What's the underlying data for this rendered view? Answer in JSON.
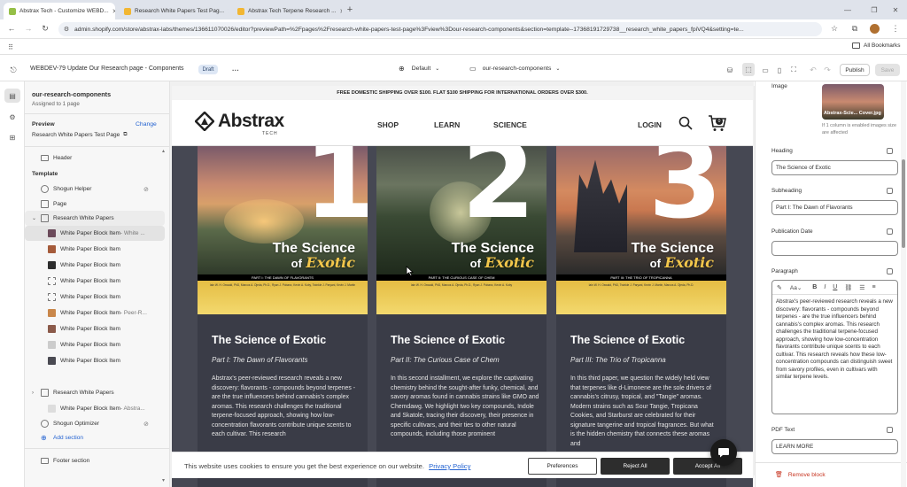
{
  "browser": {
    "tabs": [
      {
        "label": "Abstrax Tech - Customize WEBD...",
        "active": true
      },
      {
        "label": "Research White Papers Test Pag...",
        "active": false
      },
      {
        "label": "Abstrax Tech Terpene Research ...",
        "active": false
      }
    ],
    "url": "admin.shopify.com/store/abstrax-labs/themes/136611070026/editor?previewPath=%2Fpages%2Fresearch-white-papers-test-page%3Fview%3Dour-research-components&section=template--17368191729738__research_white_papers_fpiVQ4&setting=te...",
    "bookmarks_label": "All Bookmarks"
  },
  "editor": {
    "title": "WEBDEV-79 Update Our Research page - Components",
    "badge": "Draft",
    "more": "···",
    "default_label": "Default",
    "template_label": "our-research-components",
    "publish_label": "Publish",
    "save_label": "Save"
  },
  "left_panel": {
    "template_name": "our-research-components",
    "assigned": "Assigned to 1 page",
    "preview_heading": "Preview",
    "change_label": "Change",
    "preview_page": "Research White Papers Test Page",
    "header_item": "Header",
    "template_heading": "Template",
    "items": [
      {
        "label": "Shogun Helper"
      },
      {
        "label": "Page"
      },
      {
        "label": "Research White Papers"
      },
      {
        "label": "White Paper Block Item",
        "suffix": " - White ..."
      },
      {
        "label": "White Paper Block Item",
        "suffix": ""
      },
      {
        "label": "White Paper Block Item",
        "suffix": ""
      },
      {
        "label": "White Paper Block Item",
        "suffix": ""
      },
      {
        "label": "White Paper Block Item",
        "suffix": ""
      },
      {
        "label": "White Paper Block Item",
        "suffix": " - Peer-R..."
      },
      {
        "label": "White Paper Block Item",
        "suffix": ""
      },
      {
        "label": "White Paper Block Item",
        "suffix": ""
      },
      {
        "label": "White Paper Block Item",
        "suffix": ""
      },
      {
        "label": "Research White Papers"
      },
      {
        "label": "White Paper Block Item",
        "suffix": " - Abstra..."
      },
      {
        "label": "Shogun Optimizer"
      },
      {
        "label": "Add section"
      },
      {
        "label": "Footer section"
      }
    ]
  },
  "store": {
    "announcement": "FREE DOMESTIC SHIPPING OVER $100. FLAT $100 SHIPPING FOR INTERNATIONAL ORDERS OVER $300.",
    "logo": "Abstrax",
    "logo_sub": "TECH",
    "nav": [
      "SHOP",
      "LEARN",
      "SCIENCE"
    ],
    "login": "LOGIN",
    "cart_count": "0"
  },
  "cards": [
    {
      "number": "1",
      "cover_title_1": "The Science",
      "cover_title_of": "of",
      "cover_title_exotic": "Exotic",
      "part_bar": "PART I: THE DAWN OF FLAVORANTS",
      "authors": "Iain W. H. Oswald, PhD, Marcos A. Ojeda, Ph.D., Ryan J. Pobanz, Kevin A. Koby, Twinkle J. Paryani, Kevin J. Martin",
      "title": "The Science of Exotic",
      "subtitle": "Part I: The Dawn of Flavorants",
      "paragraph": "Abstrax's peer-reviewed research reveals a new discovery: flavorants - compounds beyond terpenes - are the true influencers behind cannabis's complex aromas. This research challenges the traditional terpene-focused approach, showing how low-concentration flavorants contribute unique scents to each cultivar. This research"
    },
    {
      "number": "2",
      "cover_title_1": "The Science",
      "cover_title_of": "of",
      "cover_title_exotic": "Exotic",
      "part_bar": "PART II: THE CURIOUS CASE OF CHEM",
      "authors": "Iain W. H. Oswald, PhD, Marcos A. Ojeda, Ph.D., Ryan J. Pobanz, Kevin A. Koby",
      "title": "The Science of Exotic",
      "subtitle": "Part II: The Curious Case of Chem",
      "paragraph": "In this second installment, we explore the captivating chemistry behind the sought-after funky, chemical, and savory aromas found in cannabis strains like GMO and Chemdawg. We highlight two key compounds, Indole and Skatole, tracing their discovery, their presence in specific cultivars, and their ties to other natural compounds, including those prominent"
    },
    {
      "number": "3",
      "cover_title_1": "The Science",
      "cover_title_of": "of",
      "cover_title_exotic": "Exotic",
      "part_bar": "PART III: THE TRIO OF TROPICANNA",
      "authors": "Iain W. H. Oswald, PhD, Twinkle J. Paryani, Kevin J. Martin, Marcos A. Ojeda, Ph.D.",
      "title": "The Science of Exotic",
      "subtitle": "Part III: The Trio of Tropicanna",
      "paragraph": "In this third paper, we question the widely held view that terpenes like d-Limonene are the sole drivers of cannabis's citrusy, tropical, and \"Tangie\" aromas. Modern strains such as Sour Tangie, Tropicana Cookies, and Starburst are celebrated for their signature tangerine and tropical fragrances. But what is the hidden chemistry that connects these aromas and"
    }
  ],
  "cookie": {
    "text": "This website uses cookies to ensure you get the best experience on our website.",
    "link": "Privacy Policy",
    "preferences": "Preferences",
    "reject": "Reject All",
    "accept": "Accept All"
  },
  "right_panel": {
    "image_label": "Image",
    "image_caption": "Abstrax-Scie...   Cover.jpg",
    "image_note": "If 1 column is enabled images size are affected",
    "heading_label": "Heading",
    "heading_value": "The Science of Exotic",
    "subheading_label": "Subheading",
    "subheading_value": "Part I: The Dawn of Flavorants",
    "pubdate_label": "Publication Date",
    "pubdate_value": "",
    "paragraph_label": "Paragraph",
    "paragraph_value": "Abstrax's peer-reviewed research reveals a new discovery: flavorants - compounds beyond terpenes - are the true influencers behind cannabis's complex aromas. This research challenges the traditional terpene-focused approach, showing how low-concentration flavorants contribute unique scents to each cultivar. This research reveals how these low-concentration compounds can distinguish sweet from savory profiles, even in cultivars with similar terpene levels.",
    "pdf_label": "PDF Text",
    "pdf_value": "LEARN MORE",
    "remove_label": "Remove block"
  }
}
